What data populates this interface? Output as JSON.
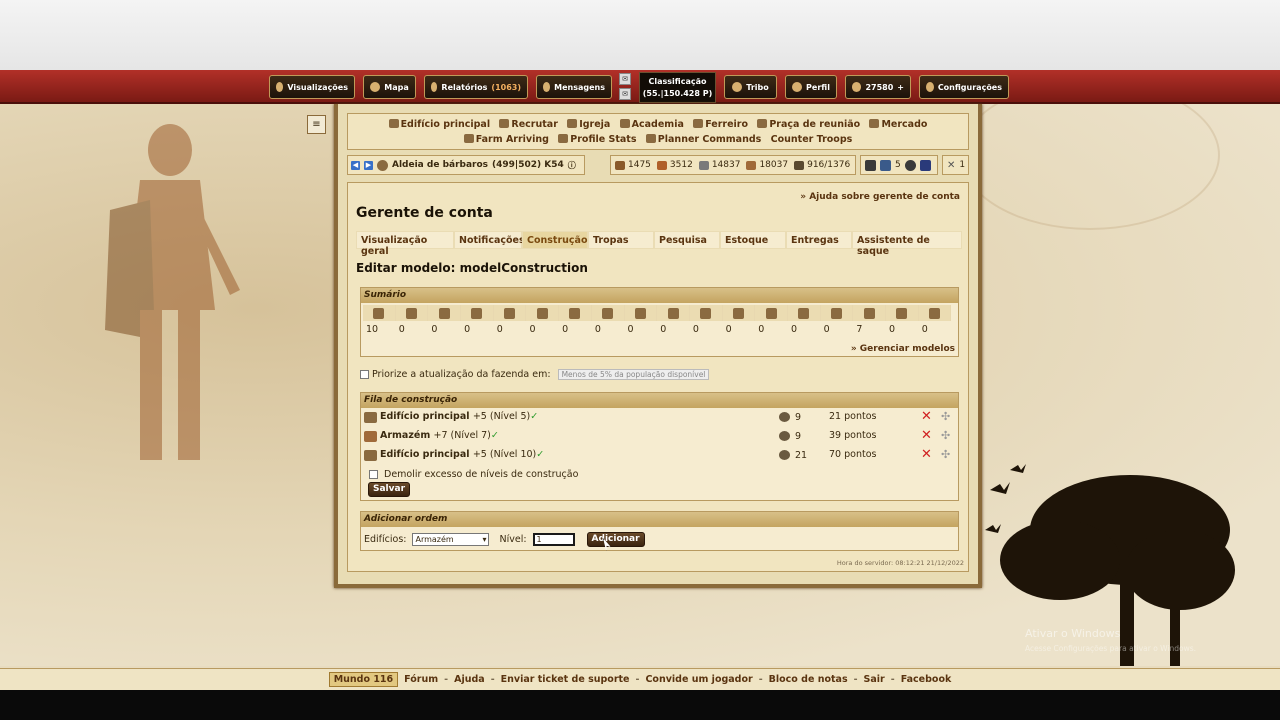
{
  "topbar": {
    "visualizacoes": "Visualizações",
    "mapa": "Mapa",
    "relatorios": "Relatórios",
    "relatorios_count": "(1063)",
    "mensagens": "Mensagens",
    "classificacao_label": "Classificação",
    "classificacao_value": "(55.|150.428 P)",
    "tribo": "Tribo",
    "perfil": "Perfil",
    "premium_points": "27580",
    "premium_plus": "+",
    "configuracoes": "Configurações"
  },
  "building_menu": [
    "Edifício principal",
    "Recrutar",
    "Igreja",
    "Academia",
    "Ferreiro",
    "Praça de reunião",
    "Mercado",
    "Farm Arriving",
    "Profile Stats",
    "Planner Commands",
    "Counter Troops"
  ],
  "village": {
    "name": "Aldeia de bárbaros",
    "coords": "(499|502) K54"
  },
  "resources": {
    "wood": "1475",
    "clay": "3512",
    "iron": "14837",
    "storage": "18037",
    "population": "916/1376"
  },
  "mini": {
    "count_a": "5",
    "count_b": "1"
  },
  "content": {
    "help_link": "» Ajuda sobre gerente de conta",
    "title": "Gerente de conta",
    "tabs": [
      "Visualização geral",
      "Notificações",
      "Construção",
      "Tropas",
      "Pesquisa",
      "Estoque",
      "Entregas",
      "Assistente de saque"
    ],
    "subtitle": "Editar modelo: modelConstruction"
  },
  "sumario": {
    "header": "Sumário",
    "values": [
      "10",
      "0",
      "0",
      "0",
      "0",
      "0",
      "0",
      "0",
      "0",
      "0",
      "0",
      "0",
      "0",
      "0",
      "0",
      "7",
      "0",
      "0"
    ],
    "gerenciar": "» Gerenciar modelos"
  },
  "prior": {
    "label": "Priorize a atualização da fazenda em:",
    "select": "Menos de 5% da população disponível"
  },
  "fila": {
    "header": "Fila de construção",
    "rows": [
      {
        "name": "Edifício principal",
        "level": "+5 (Nível 5)",
        "pop": "9",
        "points": "21 pontos"
      },
      {
        "name": "Armazém",
        "level": "+7 (Nível 7)",
        "pop": "9",
        "points": "39 pontos"
      },
      {
        "name": "Edifício principal",
        "level": "+5 (Nível 10)",
        "pop": "21",
        "points": "70 pontos"
      }
    ],
    "demolir": "Demolir excesso de níveis de construção",
    "salvar": "Salvar"
  },
  "add_order": {
    "header": "Adicionar ordem",
    "edificios_label": "Edifícios:",
    "edificios_value": "Armazém",
    "nivel_label": "Nível:",
    "nivel_value": "1",
    "button": "Adicionar"
  },
  "server_time": "Hora do servidor: 08:12:21 21/12/2022",
  "footer": {
    "world": "Mundo 116",
    "links": [
      "Fórum",
      "Ajuda",
      "Enviar ticket de suporte",
      "Convide um jogador",
      "Bloco de notas",
      "Sair",
      "Facebook"
    ]
  },
  "watermark": {
    "line1": "Ativar o Windows",
    "line2": "Acesse Configurações para ativar o Windows."
  }
}
